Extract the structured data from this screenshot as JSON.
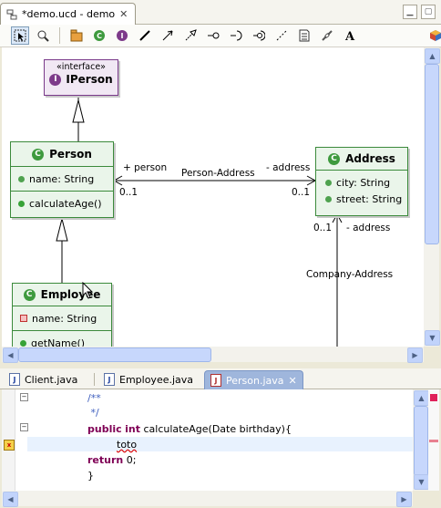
{
  "editor_tab": {
    "title": "*demo.ucd - demo"
  },
  "diagram": {
    "interface": {
      "stereotype": "«interface»",
      "name": "IPerson"
    },
    "person": {
      "name": "Person",
      "field": "name: String",
      "method": "calculateAge()"
    },
    "address": {
      "name": "Address",
      "fields": [
        "city: String",
        "street: String"
      ]
    },
    "employee": {
      "name": "Employee",
      "field": "name: String",
      "method": "getName()"
    },
    "assoc_person_address": {
      "name": "Person-Address",
      "role_left": "+ person",
      "role_right": "- address",
      "mult_left": "0..1",
      "mult_right": "0..1"
    },
    "assoc_company_address": {
      "name": "Company-Address",
      "role": "- address",
      "mult": "0..1"
    }
  },
  "bottom_tabs": [
    {
      "label": "Client.java"
    },
    {
      "label": "Employee.java"
    },
    {
      "label": "Person.java"
    }
  ],
  "code": {
    "line1": "/**",
    "line2": " */",
    "line3_kw1": "public",
    "line3_kw2": "int",
    "line3_rest": " calculateAge(Date birthday){",
    "line4": "toto",
    "line5_kw": "return",
    "line5_rest": " 0;",
    "line6": "}"
  },
  "colors": {
    "class_border": "#3b8a3b",
    "class_fill": "#eaf5ea",
    "interface_border": "#7a3a8a",
    "keyword": "#7f0055",
    "comment": "#3f5fbf"
  }
}
